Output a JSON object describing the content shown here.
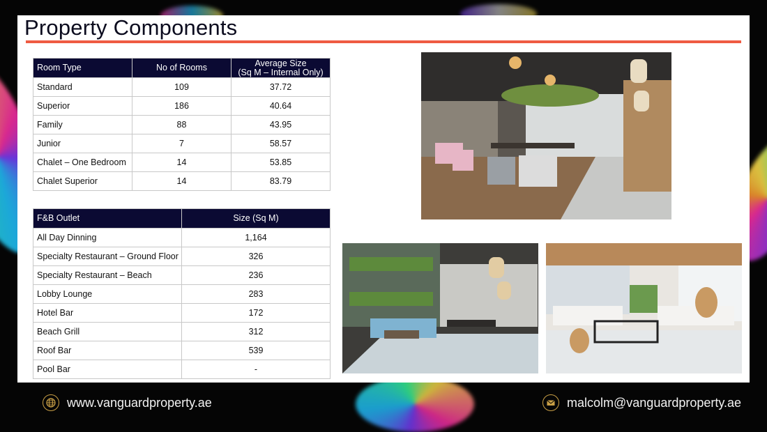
{
  "page": {
    "title": "Property Components"
  },
  "rooms_table": {
    "headers": [
      "Room Type",
      "No of Rooms",
      "Average Size",
      "(Sq M – Internal Only)"
    ],
    "rows": [
      [
        "Standard",
        "109",
        "37.72"
      ],
      [
        "Superior",
        "186",
        "40.64"
      ],
      [
        "Family",
        "88",
        "43.95"
      ],
      [
        "Junior",
        "7",
        "58.57"
      ],
      [
        "Chalet – One Bedroom",
        "14",
        "53.85"
      ],
      [
        "Chalet Superior",
        "14",
        "83.79"
      ]
    ]
  },
  "fb_table": {
    "headers": [
      "F&B Outlet",
      "Size (Sq M)"
    ],
    "rows": [
      [
        "All Day Dinning",
        "1,164"
      ],
      [
        "Specialty Restaurant – Ground Floor",
        "326"
      ],
      [
        "Specialty Restaurant – Beach",
        "236"
      ],
      [
        "Lobby Lounge",
        "283"
      ],
      [
        "Hotel Bar",
        "172"
      ],
      [
        "Beach Grill",
        "312"
      ],
      [
        "Roof Bar",
        "539"
      ],
      [
        "Pool Bar",
        "-"
      ]
    ]
  },
  "footer": {
    "website": "www.vanguardproperty.ae",
    "email": "malcolm@vanguardproperty.ae",
    "website_icon": "globe-icon",
    "email_icon": "envelope-icon"
  },
  "colors": {
    "accent_rule": "#ef5b42",
    "table_header": "#0b0a33",
    "icon_gold": "#caa046"
  }
}
